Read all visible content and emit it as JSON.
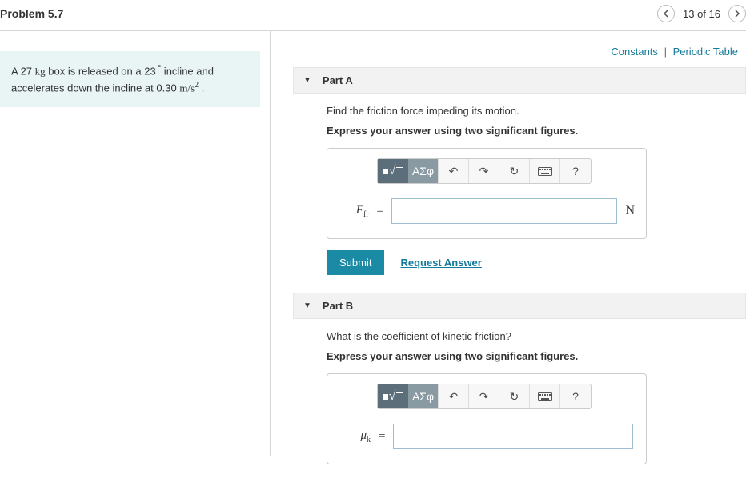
{
  "header": {
    "title": "Problem 5.7",
    "position": "13 of 16"
  },
  "links": {
    "constants": "Constants",
    "periodic": "Periodic Table"
  },
  "given": {
    "text_prefix": "A 27 ",
    "unit_kg": "kg",
    "text_mid1": " box is released on a 23",
    "deg": " °",
    "text_mid2": " incline and accelerates down the incline at 0.30 ",
    "unit_ms2_m": "m/s",
    "sq": "2",
    "text_end": " ."
  },
  "partA": {
    "label": "Part A",
    "question": "Find the friction force impeding its motion.",
    "instruction": "Express your answer using two significant figures.",
    "var_main": "F",
    "var_sub": "fr",
    "equals": "=",
    "unit": "N",
    "submit": "Submit",
    "request": "Request Answer",
    "toolbar": {
      "greek": "ΑΣφ",
      "undo": "↶",
      "redo": "↷",
      "reset": "↻",
      "help": "?"
    }
  },
  "partB": {
    "label": "Part B",
    "question": "What is the coefficient of kinetic friction?",
    "instruction": "Express your answer using two significant figures.",
    "var_main": "μ",
    "var_sub": "k",
    "equals": "=",
    "toolbar": {
      "greek": "ΑΣφ",
      "undo": "↶",
      "redo": "↷",
      "reset": "↻",
      "help": "?"
    }
  }
}
